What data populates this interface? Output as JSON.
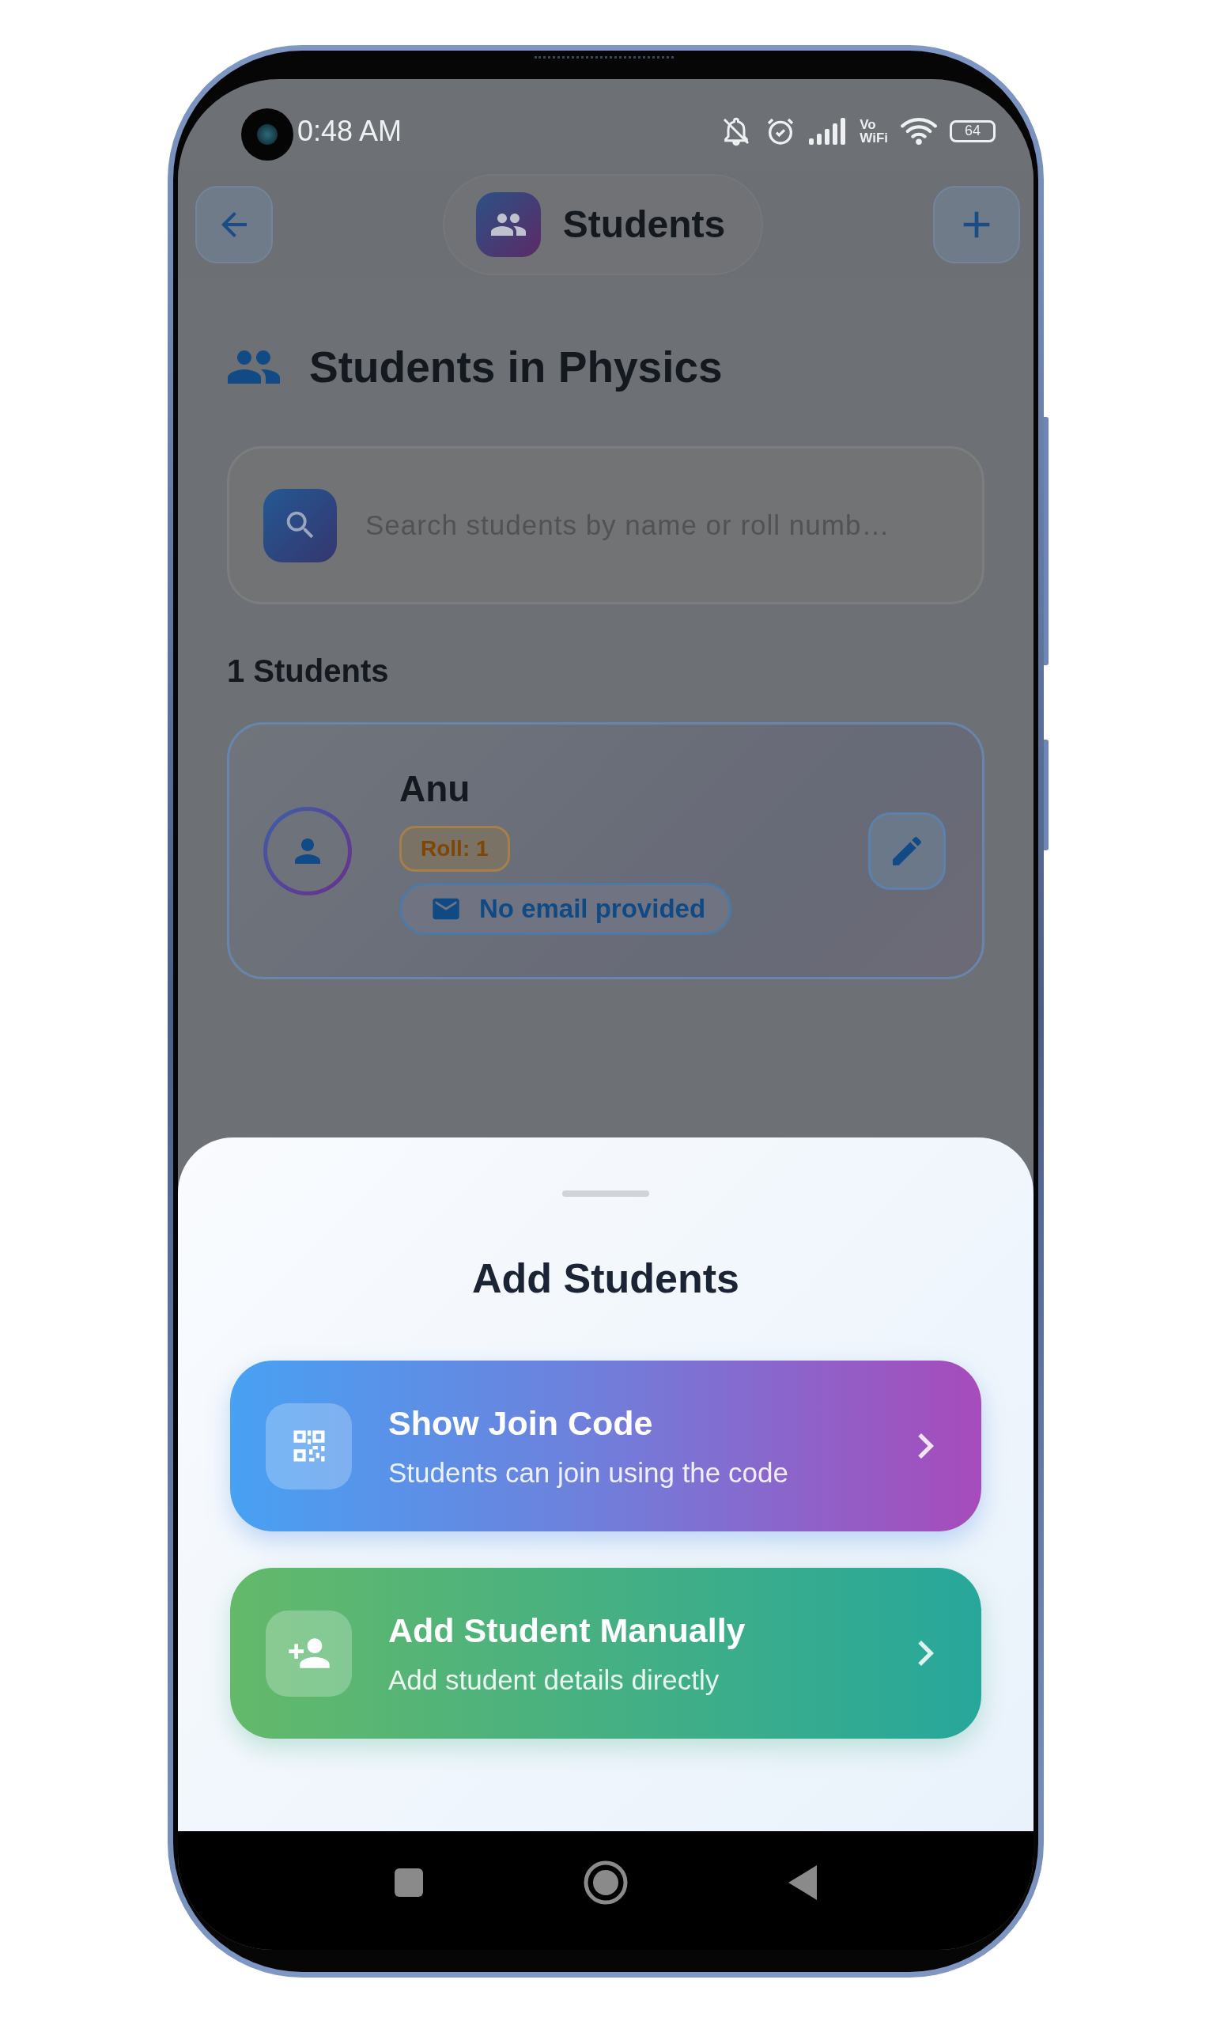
{
  "status_bar": {
    "time": "0:48 AM",
    "network_label_top": "Vo",
    "network_label_bottom": "WiFi",
    "battery": "64"
  },
  "header": {
    "title": "Students"
  },
  "section": {
    "title": "Students in Physics"
  },
  "search": {
    "placeholder": "Search students by name or roll numb…"
  },
  "count_label": "1 Students",
  "students": [
    {
      "name": "Anu",
      "roll": "Roll: 1",
      "email": "No email provided"
    }
  ],
  "sheet": {
    "title": "Add Students",
    "options": [
      {
        "kind": "code",
        "title": "Show Join Code",
        "subtitle": "Students can join using the code"
      },
      {
        "kind": "manual",
        "title": "Add Student Manually",
        "subtitle": "Add student details directly"
      }
    ]
  }
}
